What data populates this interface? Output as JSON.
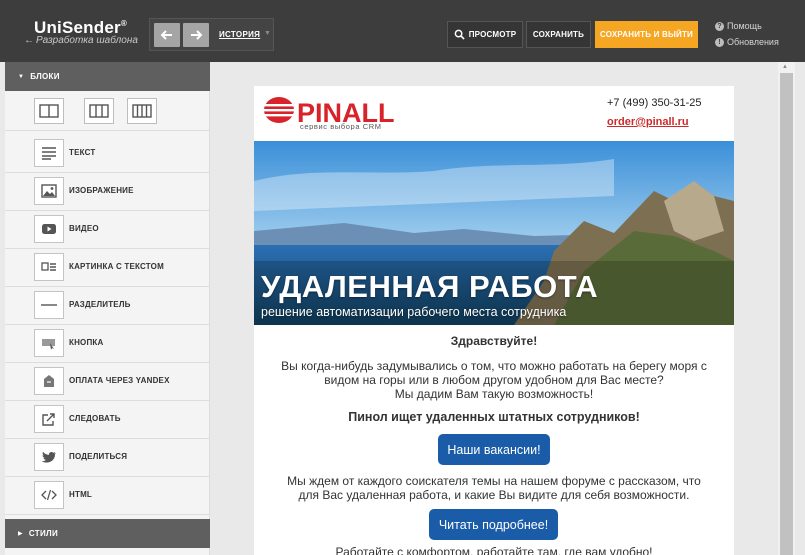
{
  "app": {
    "brand": "UniSender",
    "brand_mark": "®",
    "subtitle": "Разработка шаблона",
    "back_arrow": "←"
  },
  "toolbar": {
    "history_label": "ИСТОРИЯ",
    "preview_label": "ПРОСМОТР",
    "save_label": "СОХРАНИТЬ",
    "save_exit_label": "СОХРАНИТЬ И ВЫЙТИ",
    "help_label": "Помощь",
    "updates_label": "Обновления",
    "help_glyph": "?",
    "updates_glyph": "!",
    "accent_color": "#f5a623"
  },
  "sidebar": {
    "blocks_title": "БЛОКИ",
    "styles_title": "СТИЛИ",
    "items": [
      {
        "label": "ТЕКСТ",
        "icon": "text-icon"
      },
      {
        "label": "ИЗОБРАЖЕНИЕ",
        "icon": "image-icon"
      },
      {
        "label": "ВИДЕО",
        "icon": "video-icon"
      },
      {
        "label": "КАРТИНКА С ТЕКСТОМ",
        "icon": "image-text-icon"
      },
      {
        "label": "РАЗДЕЛИТЕЛЬ",
        "icon": "divider-icon"
      },
      {
        "label": "КНОПКА",
        "icon": "button-icon"
      },
      {
        "label": "ОПЛАТА ЧЕРЕЗ YANDEX",
        "icon": "yandex-payment-icon"
      },
      {
        "label": "СЛЕДОВАТЬ",
        "icon": "follow-icon"
      },
      {
        "label": "ПОДЕЛИТЬСЯ",
        "icon": "twitter-icon"
      },
      {
        "label": "HTML",
        "icon": "html-code-icon"
      }
    ]
  },
  "email": {
    "logo_text": "PINALL",
    "logo_tagline": "сервис выбора CRM",
    "phone": "+7 (499) 350-31-25",
    "email": "order@pinall.ru",
    "banner_title": "УДАЛЕННАЯ РАБОТА",
    "banner_subtitle": "решение автоматизации рабочего места сотрудника",
    "greeting": "Здравствуйте!",
    "para1": [
      "Вы когда-нибудь задумывались о том, что можно работать на берегу моря с",
      "видом на горы или в любом другом удобном для Вас месте?",
      "Мы дадим Вам такую возможность!"
    ],
    "heading2": "Пинол ищет удаленных штатных сотрудников!",
    "button1": "Наши вакансии!",
    "para2": [
      "Мы ждем от каждого соискателя темы на нашем форуме с рассказом, что",
      "для Вас удаленная работа, и какие Вы видите для себя возможности."
    ],
    "button2": "Читать подробнее!",
    "para3": "Работайте с комфортом, работайте там, где вам удобно!",
    "brand_red": "#d8232a",
    "button_color": "#1a5ca8"
  }
}
